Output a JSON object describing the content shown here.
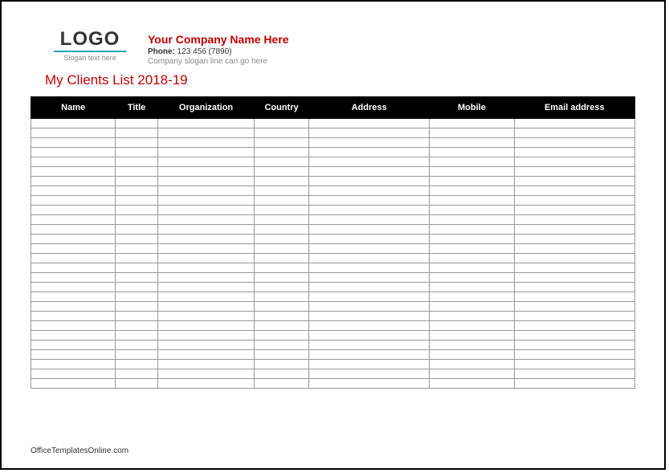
{
  "logo": {
    "text": "LOGO",
    "tagline": "Slogan text here"
  },
  "company": {
    "name": "Your Company Name Here",
    "phone_label": "Phone:",
    "phone_value": "123 456 (7890)",
    "slogan": "Company slogan line can go here"
  },
  "document": {
    "title": "My Clients List 2018-19"
  },
  "table": {
    "columns": [
      "Name",
      "Title",
      "Organization",
      "Country",
      "Address",
      "Mobile",
      "Email address"
    ],
    "row_count": 28
  },
  "footer": {
    "credit": "OfficeTemplatesOnline.com"
  }
}
